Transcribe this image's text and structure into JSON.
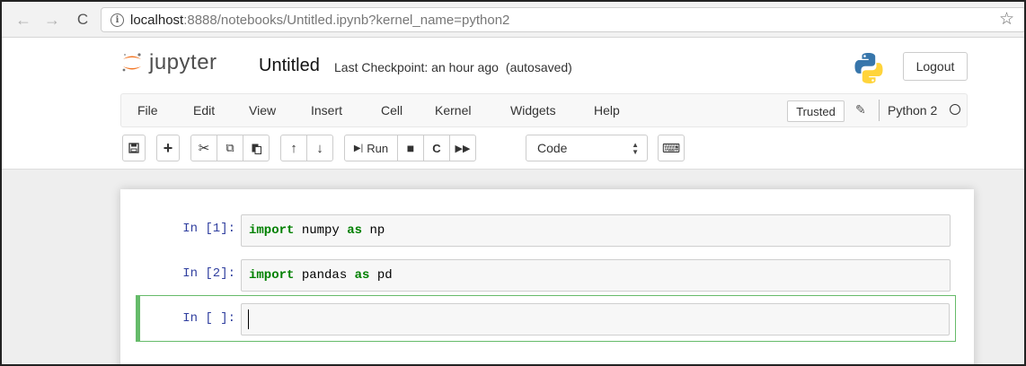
{
  "browser": {
    "url_host": "localhost",
    "url_rest": ":8888/notebooks/Untitled.ipynb?kernel_name=python2",
    "back_icon": "←",
    "forward_icon": "→",
    "reload_icon": "C",
    "info_icon": "i",
    "star_icon": "☆"
  },
  "header": {
    "logo_text": "jupyter",
    "notebook_title": "Untitled",
    "checkpoint": "Last Checkpoint: an hour ago",
    "autosave": "(autosaved)",
    "logout_label": "Logout"
  },
  "menubar": {
    "items": [
      "File",
      "Edit",
      "View",
      "Insert",
      "Cell",
      "Kernel",
      "Widgets",
      "Help"
    ],
    "trusted_label": "Trusted",
    "pencil_icon": "✎",
    "kernel_name": "Python 2"
  },
  "toolbar": {
    "save_icon": "🖫",
    "add_icon": "+",
    "cut_icon": "✂",
    "copy_icon": "⧉",
    "paste_icon": "📋",
    "up_icon": "🡑",
    "down_icon": "🡓",
    "run_label": "Run",
    "stop_icon": "■",
    "restart_icon": "C",
    "fastforward_icon": "⏩",
    "cell_type": "Code",
    "keyboard_icon": "⌨"
  },
  "cells": [
    {
      "prompt": "In [1]:",
      "kw1": "import",
      "mod": "numpy",
      "kw2": "as",
      "alias": "np"
    },
    {
      "prompt": "In [2]:",
      "kw1": "import",
      "mod": "pandas",
      "kw2": "as",
      "alias": "pd"
    },
    {
      "prompt": "In [ ]:"
    }
  ],
  "colors": {
    "keyword": "#008000",
    "prompt": "#303f9f",
    "selected_cell_border": "#66bb6a",
    "jupyter_orange": "#f37726"
  }
}
